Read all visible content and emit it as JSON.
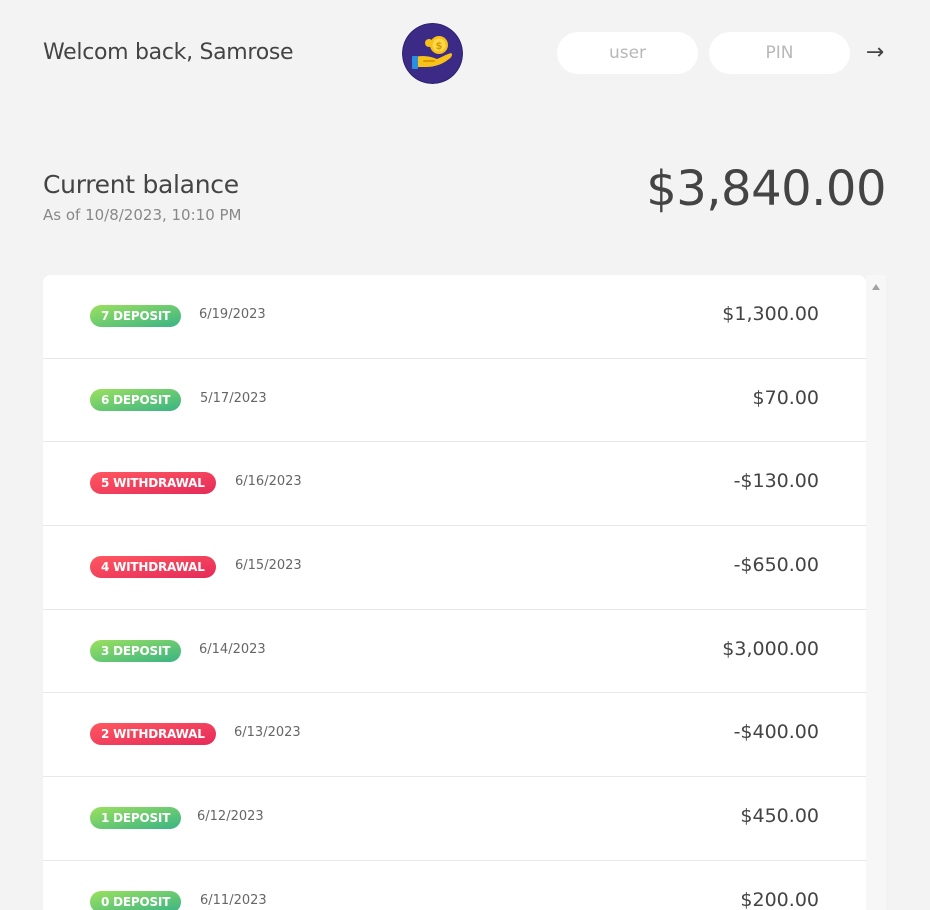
{
  "nav": {
    "welcome": "Welcom back, Samrose",
    "logo_icon": "hand-holding-coin-icon",
    "user_placeholder": "user",
    "pin_placeholder": "PIN",
    "login_arrow": "→"
  },
  "balance": {
    "label": "Current balance",
    "date": "As of 10/8/2023, 10:10 PM",
    "value": "$3,840.00"
  },
  "movements": [
    {
      "type": "7 DEPOSIT",
      "kind": "deposit",
      "date": "6/19/2023",
      "value": "$1,300.00"
    },
    {
      "type": "6 DEPOSIT",
      "kind": "deposit",
      "date": "5/17/2023",
      "value": "$70.00"
    },
    {
      "type": "5 WITHDRAWAL",
      "kind": "withdrawal",
      "date": "6/16/2023",
      "value": "-$130.00"
    },
    {
      "type": "4 WITHDRAWAL",
      "kind": "withdrawal",
      "date": "6/15/2023",
      "value": "-$650.00"
    },
    {
      "type": "3 DEPOSIT",
      "kind": "deposit",
      "date": "6/14/2023",
      "value": "$3,000.00"
    },
    {
      "type": "2 WITHDRAWAL",
      "kind": "withdrawal",
      "date": "6/13/2023",
      "value": "-$400.00"
    },
    {
      "type": "1 DEPOSIT",
      "kind": "deposit",
      "date": "6/12/2023",
      "value": "$450.00"
    },
    {
      "type": "0 DEPOSIT",
      "kind": "deposit",
      "date": "6/11/2023",
      "value": "$200.00"
    }
  ],
  "colors": {
    "deposit": "#39b385",
    "withdrawal": "#e52a5a",
    "logo_bg": "#3b2a86",
    "coin": "#f7c11a"
  }
}
